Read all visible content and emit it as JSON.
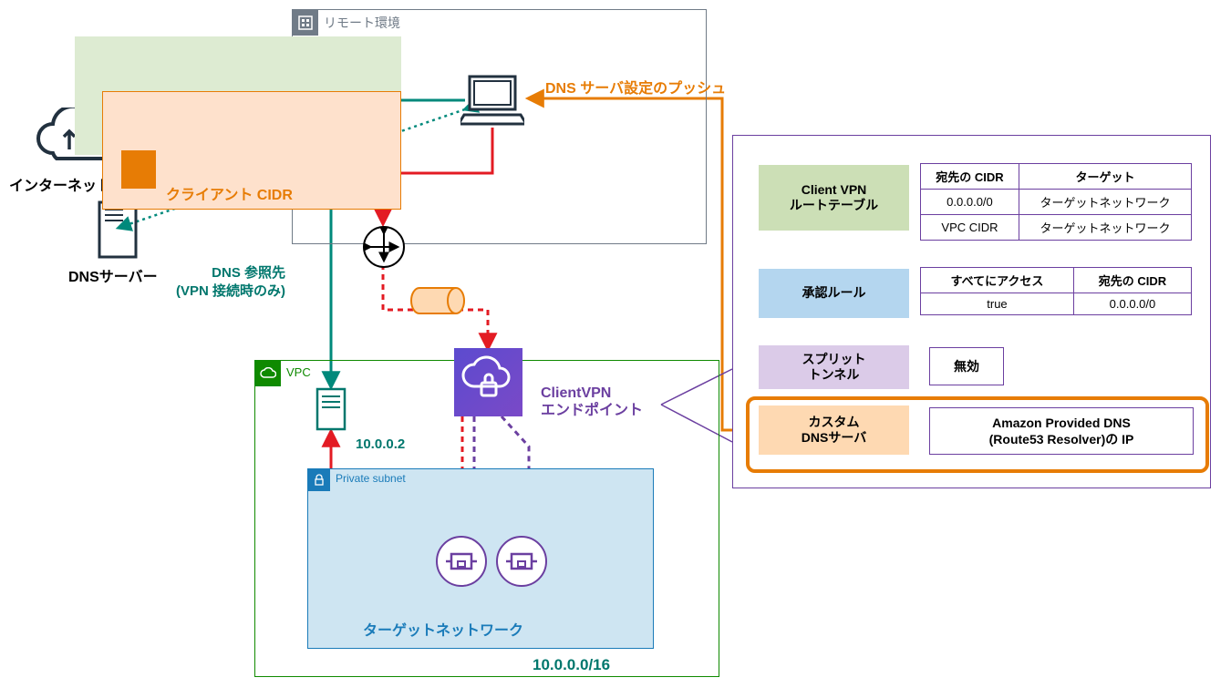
{
  "remote": {
    "title": "リモート環境",
    "client_cidr_label": "クライアント CIDR"
  },
  "internet": {
    "label": "インターネット"
  },
  "dns_server": {
    "label": "DNSサーバー"
  },
  "labels": {
    "dns_push": "DNS サーバ設定のプッシュ",
    "dns_ref_1": "DNS 参照先",
    "dns_ref_2": "(VPN 接続時のみ)"
  },
  "vpc": {
    "title": "VPC",
    "cidr": "10.0.0.0/16",
    "resolver_ip": "10.0.0.2",
    "subnet_title": "Private subnet",
    "target_network_label": "ターゲットネットワーク"
  },
  "vpn_endpoint": {
    "label_1": "ClientVPN",
    "label_2": "エンドポイント"
  },
  "panel": {
    "route_table": {
      "label_1": "Client VPN",
      "label_2": "ルートテーブル",
      "headers": [
        "宛先の CIDR",
        "ターゲット"
      ],
      "rows": [
        [
          "0.0.0.0/0",
          "ターゲットネットワーク"
        ],
        [
          "VPC CIDR",
          "ターゲットネットワーク"
        ]
      ]
    },
    "auth_rules": {
      "label": "承認ルール",
      "headers": [
        "すべてにアクセス",
        "宛先の CIDR"
      ],
      "rows": [
        [
          "true",
          "0.0.0.0/0"
        ]
      ]
    },
    "split_tunnel": {
      "label_1": "スプリット",
      "label_2": "トンネル",
      "value": "無効"
    },
    "custom_dns": {
      "label_1": "カスタム",
      "label_2": "DNSサーバ",
      "value_1": "Amazon Provided DNS",
      "value_2": "(Route53 Resolver)の IP"
    }
  }
}
